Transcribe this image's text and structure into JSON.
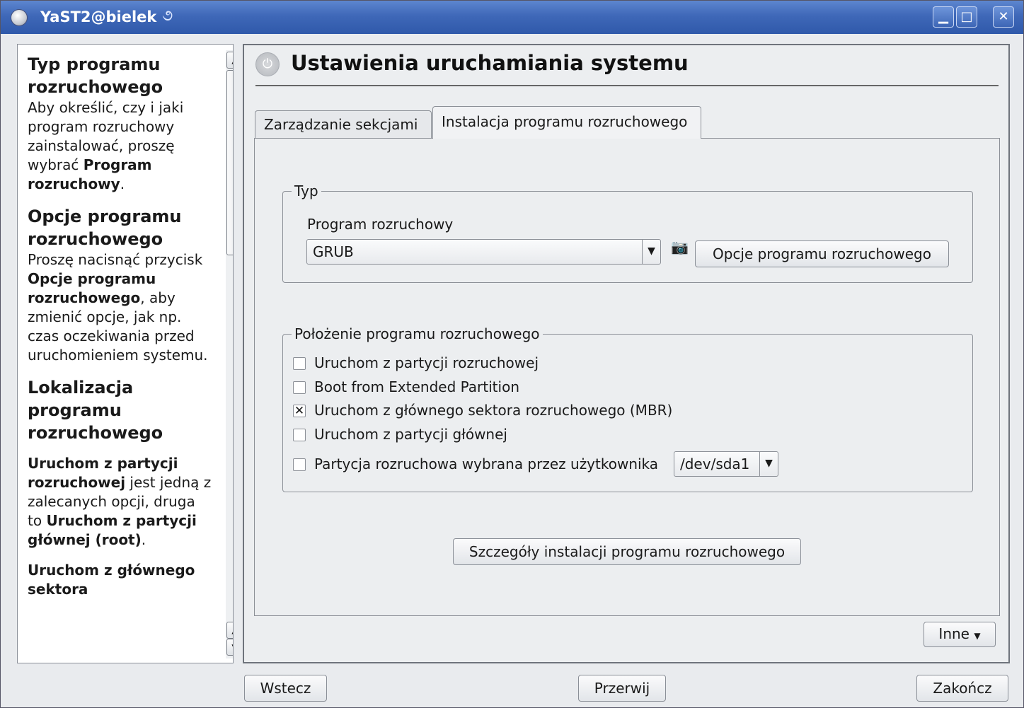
{
  "window": {
    "title": "YaST2@bielek"
  },
  "help": {
    "section1_title": "Typ programu rozruchowego",
    "section1_text": "Aby określić, czy i jaki program rozruchowy zainstalować, proszę wybrać",
    "section1_bold": "Program rozruchowy",
    "section1_end": ".",
    "section2_title": "Opcje programu rozruchowego",
    "section2_text1": "Proszę nacisnąć przycisk",
    "section2_bold": "Opcje programu rozruchowego",
    "section2_text2": ", aby zmienić opcje, jak np. czas oczekiwania przed uruchomieniem systemu.",
    "section3_title": "Lokalizacja programu rozruchowego",
    "section3_bold1": "Uruchom z partycji rozruchowej",
    "section3_text1": " jest jedną z zalecanych opcji, druga to ",
    "section3_bold2": "Uruchom z partycji głównej (root)",
    "section3_end": ".",
    "section4_bold": "Uruchom z głównego sektora"
  },
  "main": {
    "title": "Ustawienia uruchamiania systemu",
    "tabs": [
      {
        "label": "Zarządzanie sekcjami"
      },
      {
        "label": "Instalacja programu rozruchowego"
      }
    ],
    "type_group": {
      "legend": "Typ",
      "bootloader_label": "Program rozruchowy",
      "bootloader_value": "GRUB",
      "options_button": "Opcje programu rozruchowego"
    },
    "location_group": {
      "legend": "Położenie programu rozruchowego",
      "options": [
        {
          "label": "Uruchom z partycji rozruchowej",
          "checked": false
        },
        {
          "label": "Boot from Extended Partition",
          "checked": false
        },
        {
          "label": "Uruchom z głównego sektora rozruchowego (MBR)",
          "checked": true
        },
        {
          "label": "Uruchom z partycji głównej",
          "checked": false
        },
        {
          "label": "Partycja rozruchowa wybrana przez użytkownika",
          "checked": false
        }
      ],
      "custom_partition_value": "/dev/sda1"
    },
    "details_button": "Szczegóły instalacji programu rozruchowego",
    "other_button": "Inne"
  },
  "footer": {
    "back": "Wstecz",
    "abort": "Przerwij",
    "finish": "Zakończ"
  }
}
